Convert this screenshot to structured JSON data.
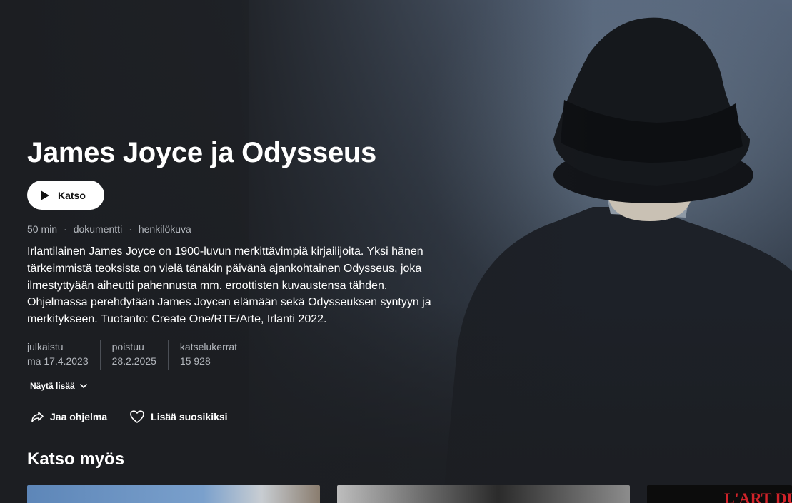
{
  "program": {
    "title": "James Joyce ja Odysseus",
    "watch_label": "Katso",
    "meta": [
      "50 min",
      "dokumentti",
      "henkilökuva"
    ],
    "meta_separator": "·",
    "description": "Irlantilainen James Joyce on 1900-luvun merkittävimpiä kirjailijoita. Yksi hänen tärkeimmistä teoksista on vielä tänäkin päivänä ajankohtainen Odysseus, joka ilmestyttyään aiheutti pahennusta mm. eroottisten kuvaustensa tähden. Ohjelmassa perehdytään James Joycen elämään sekä Odysseuksen syntyyn ja merkitykseen. Tuotanto: Create One/RTE/Arte, Irlanti 2022.",
    "stats": [
      {
        "label": "julkaistu",
        "value": "ma 17.4.2023"
      },
      {
        "label": "poistuu",
        "value": "28.2.2025"
      },
      {
        "label": "katselukerrat",
        "value": "15 928"
      }
    ],
    "show_more_label": "Näytä lisää",
    "share_label": "Jaa ohjelma",
    "favorite_label": "Lisää suosikiksi"
  },
  "see_also": {
    "title": "Katso myös",
    "cards": [
      {
        "text": ""
      },
      {
        "text": ""
      },
      {
        "text": "L'ART DU"
      }
    ]
  },
  "colors": {
    "background": "#1c1e22",
    "button_bg": "#ffffff",
    "muted_text": "#b3b7bd",
    "card_accent": "#d2232a"
  },
  "icons": [
    "play-icon",
    "share-icon",
    "heart-icon",
    "chevron-down-icon"
  ]
}
